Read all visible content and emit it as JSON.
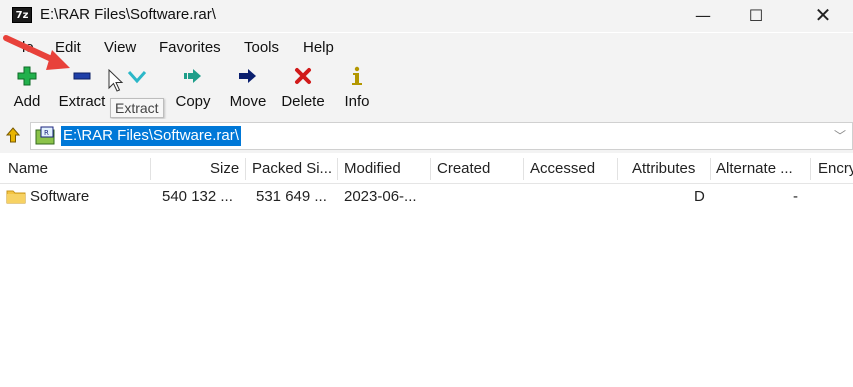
{
  "window": {
    "logo_text": "7z",
    "title": "E:\\RAR Files\\Software.rar\\",
    "minimize_glyph": "—",
    "maximize_glyph": "☐",
    "close_glyph": "✕"
  },
  "menu": {
    "file_partial": "le",
    "edit": "Edit",
    "view": "View",
    "favorites": "Favorites",
    "tools": "Tools",
    "help": "Help"
  },
  "toolbar": {
    "add": {
      "label": "Add",
      "icon": "plus-icon",
      "color": "#22b14c"
    },
    "extract": {
      "label": "Extract",
      "icon": "minus-icon",
      "color": "#1f3fa8"
    },
    "test": {
      "label": "",
      "icon": "checkmark-icon",
      "color": "#2bb7c8"
    },
    "copy": {
      "label": "Copy",
      "icon": "double-arrow-right-icon",
      "color": "#1e9e8a"
    },
    "move": {
      "label": "Move",
      "icon": "arrow-right-icon",
      "color": "#0a1f6e"
    },
    "delete": {
      "label": "Delete",
      "icon": "x-icon",
      "color": "#d11a1a"
    },
    "info": {
      "label": "Info",
      "icon": "info-icon",
      "color": "#b39700"
    }
  },
  "tooltip": "Extract",
  "address": {
    "path": "E:\\RAR Files\\Software.rar\\",
    "dropdown_glyph": "﹀",
    "selection_color": "#0078d7"
  },
  "columns": [
    "Name",
    "Size",
    "Packed Si...",
    "Modified",
    "Created",
    "Accessed",
    "Attributes",
    "Alternate ...",
    "Encry"
  ],
  "rows": [
    {
      "name": "Software",
      "size": "540 132 ...",
      "packed": "531 649 ...",
      "modified": "2023-06-...",
      "created": "",
      "accessed": "",
      "attributes": "D",
      "alternate": "-",
      "encrypted": ""
    }
  ],
  "annotation": {
    "color": "#e8413a"
  }
}
